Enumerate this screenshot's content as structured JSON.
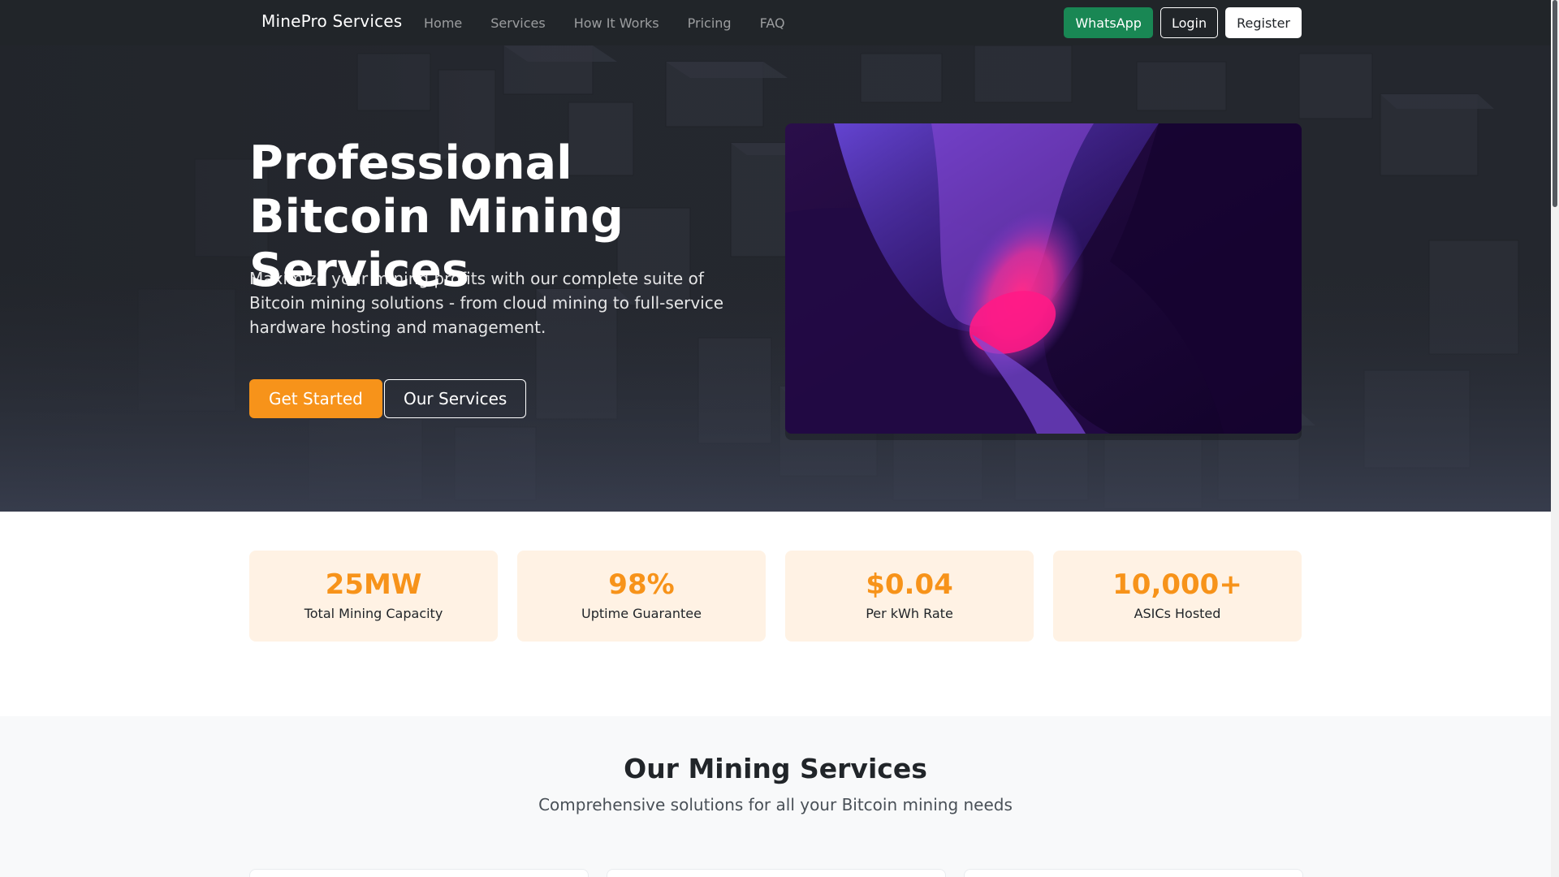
{
  "navbar": {
    "brand": "MinePro Services",
    "links": [
      "Home",
      "Services",
      "How It Works",
      "Pricing",
      "FAQ"
    ],
    "whatsapp_label": "WhatsApp",
    "login_label": "Login",
    "register_label": "Register"
  },
  "hero": {
    "title": "Professional Bitcoin Mining Services",
    "lead": "Maximize your mining profits with our complete suite of Bitcoin mining solutions - from cloud mining to full-service hardware hosting and management.",
    "get_started_label": "Get Started",
    "our_services_label": "Our Services"
  },
  "stats": [
    {
      "value": "25MW",
      "label": "Total Mining Capacity"
    },
    {
      "value": "98%",
      "label": "Uptime Guarantee"
    },
    {
      "value": "$0.04",
      "label": "Per kWh Rate"
    },
    {
      "value": "10,000+",
      "label": "ASICs Hosted"
    }
  ],
  "services": {
    "title": "Our Mining Services",
    "subtitle": "Comprehensive solutions for all your Bitcoin mining needs"
  },
  "colors": {
    "accent": "#f7931a",
    "whatsapp": "#198754",
    "navbar": "#212529",
    "stat_bg": "#fff2e4"
  }
}
